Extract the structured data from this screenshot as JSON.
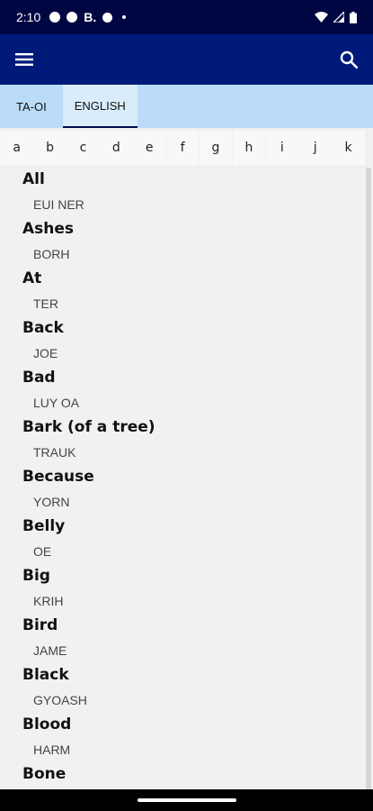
{
  "status_bar": {
    "time": "2:10",
    "icons": [
      "messenger-icon",
      "notification-icon",
      "b-icon",
      "pinterest-icon",
      "dot-icon",
      "wifi-icon",
      "signal-icon",
      "battery-icon"
    ],
    "b_label": "B."
  },
  "app_bar": {
    "menu_icon": "hamburger-menu-icon",
    "search_icon": "search-icon",
    "color": "#001a7a"
  },
  "tabs": [
    {
      "label": "TA-OI",
      "active": false
    },
    {
      "label": "ENGLISH",
      "active": true
    }
  ],
  "alphabet": [
    "a",
    "b",
    "c",
    "d",
    "e",
    "f",
    "g",
    "h",
    "i",
    "j",
    "k"
  ],
  "entries": [
    {
      "word": "All",
      "translation": "EUI NER"
    },
    {
      "word": "Ashes",
      "translation": "BORH"
    },
    {
      "word": "At",
      "translation": "TER"
    },
    {
      "word": "Back",
      "translation": "JOE"
    },
    {
      "word": "Bad",
      "translation": "LUY OA"
    },
    {
      "word": "Bark (of a tree)",
      "translation": "TRAUK"
    },
    {
      "word": "Because",
      "translation": "YORN"
    },
    {
      "word": "Belly",
      "translation": "OE"
    },
    {
      "word": "Big",
      "translation": "KRIH"
    },
    {
      "word": "Bird",
      "translation": "JAME"
    },
    {
      "word": "Black",
      "translation": "GYOASH"
    },
    {
      "word": "Blood",
      "translation": "HARM"
    },
    {
      "word": "Bone",
      "translation": ""
    }
  ]
}
